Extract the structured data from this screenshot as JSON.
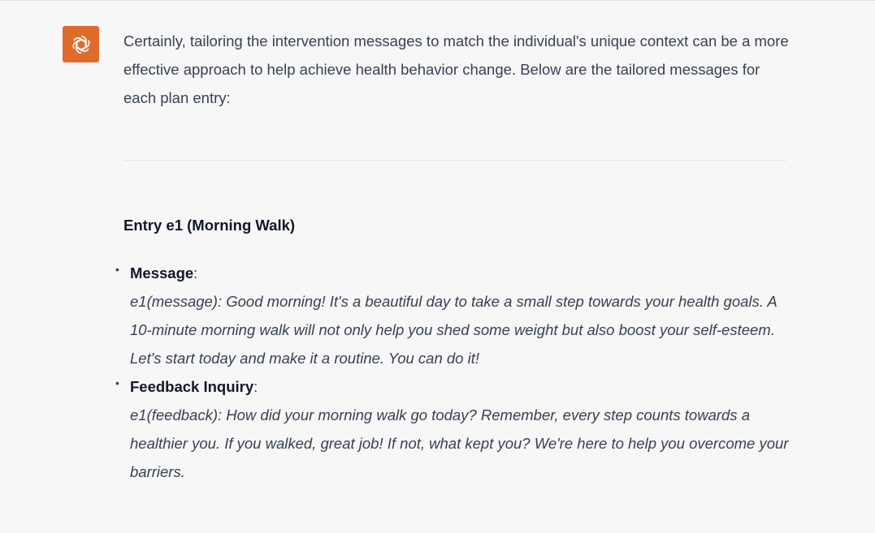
{
  "assistant": {
    "avatar_icon": "openai-logo-icon",
    "avatar_color": "#e06c2c"
  },
  "intro_text": "Certainly, tailoring the intervention messages to match the individual's unique context can be a more effective approach to help achieve health behavior change. Below are the tailored messages for each plan entry:",
  "entry": {
    "title": "Entry e1 (Morning Walk)",
    "items": [
      {
        "label": "Message",
        "colon": ":",
        "text": "e1(message): Good morning! It's a beautiful day to take a small step towards your health goals. A 10-minute morning walk will not only help you shed some weight but also boost your self-esteem. Let's start today and make it a routine. You can do it!"
      },
      {
        "label": "Feedback Inquiry",
        "colon": ":",
        "text": "e1(feedback): How did your morning walk go today? Remember, every step counts towards a healthier you. If you walked, great job! If not, what kept you? We're here to help you overcome your barriers."
      }
    ]
  }
}
